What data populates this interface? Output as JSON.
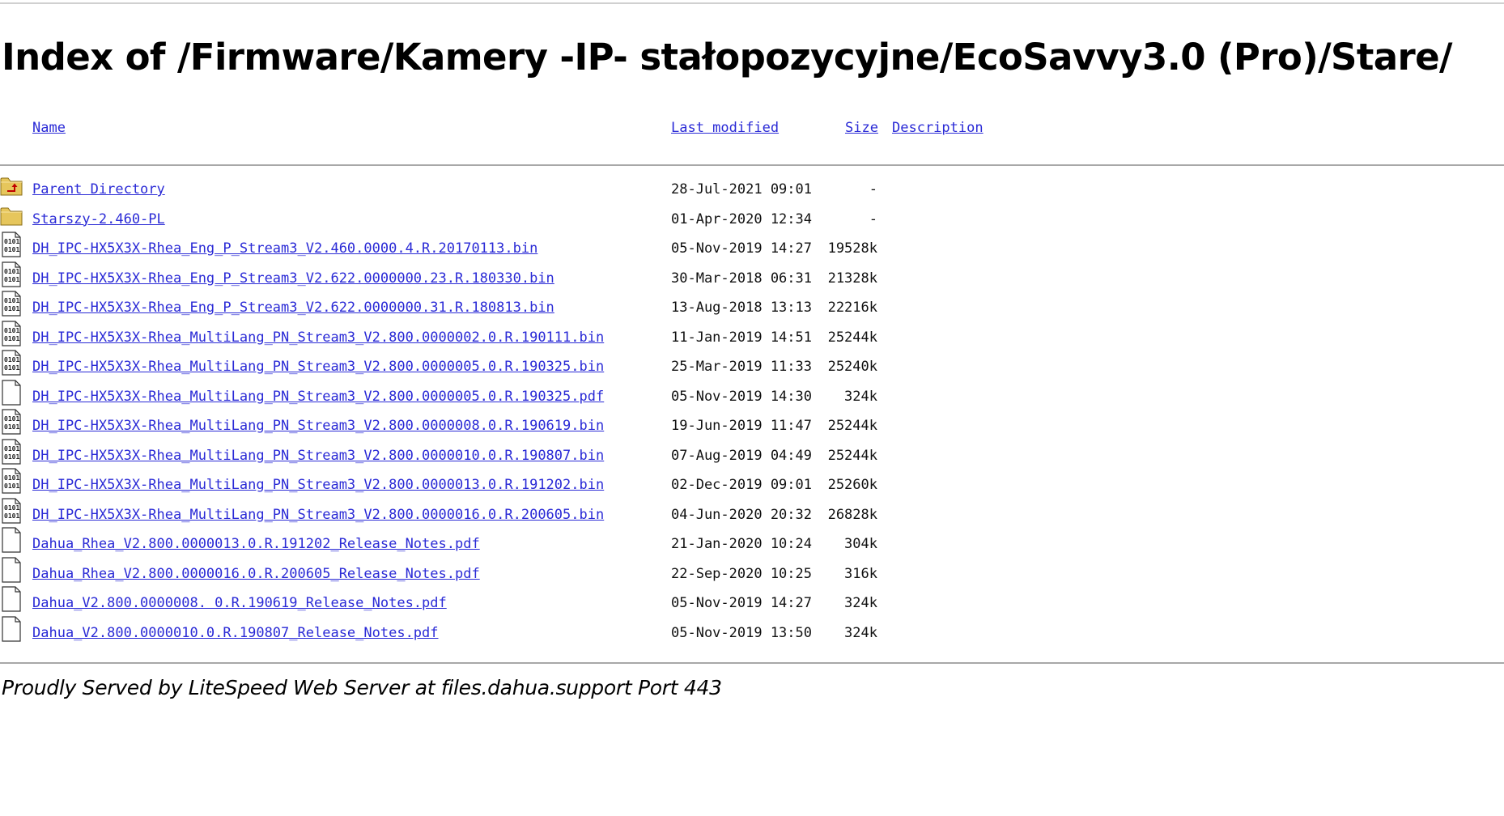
{
  "page": {
    "title": "Index of /Firmware/Kamery -IP- stałopozycyjne/EcoSavvy3.0 (Pro)/Stare/"
  },
  "columns": {
    "name": "Name",
    "last_modified": "Last modified",
    "size": "Size",
    "description": "Description"
  },
  "entries": [
    {
      "icon": "folder-up-icon",
      "name": "Parent Directory",
      "modified": "28-Jul-2021 09:01",
      "size": "-"
    },
    {
      "icon": "folder-icon",
      "name": "Starszy-2.460-PL",
      "modified": "01-Apr-2020 12:34",
      "size": "-"
    },
    {
      "icon": "binary-file-icon",
      "name": "DH_IPC-HX5X3X-Rhea_Eng_P_Stream3_V2.460.0000.4.R.20170113.bin",
      "modified": "05-Nov-2019 14:27",
      "size": "19528k"
    },
    {
      "icon": "binary-file-icon",
      "name": "DH_IPC-HX5X3X-Rhea_Eng_P_Stream3_V2.622.0000000.23.R.180330.bin",
      "modified": "30-Mar-2018 06:31",
      "size": "21328k"
    },
    {
      "icon": "binary-file-icon",
      "name": "DH_IPC-HX5X3X-Rhea_Eng_P_Stream3_V2.622.0000000.31.R.180813.bin",
      "modified": "13-Aug-2018 13:13",
      "size": "22216k"
    },
    {
      "icon": "binary-file-icon",
      "name": "DH_IPC-HX5X3X-Rhea_MultiLang_PN_Stream3_V2.800.0000002.0.R.190111.bin",
      "modified": "11-Jan-2019 14:51",
      "size": "25244k"
    },
    {
      "icon": "binary-file-icon",
      "name": "DH_IPC-HX5X3X-Rhea_MultiLang_PN_Stream3_V2.800.0000005.0.R.190325.bin",
      "modified": "25-Mar-2019 11:33",
      "size": "25240k"
    },
    {
      "icon": "blank-file-icon",
      "name": "DH_IPC-HX5X3X-Rhea_MultiLang_PN_Stream3_V2.800.0000005.0.R.190325.pdf",
      "modified": "05-Nov-2019 14:30",
      "size": "324k"
    },
    {
      "icon": "binary-file-icon",
      "name": "DH_IPC-HX5X3X-Rhea_MultiLang_PN_Stream3_V2.800.0000008.0.R.190619.bin",
      "modified": "19-Jun-2019 11:47",
      "size": "25244k"
    },
    {
      "icon": "binary-file-icon",
      "name": "DH_IPC-HX5X3X-Rhea_MultiLang_PN_Stream3_V2.800.0000010.0.R.190807.bin",
      "modified": "07-Aug-2019 04:49",
      "size": "25244k"
    },
    {
      "icon": "binary-file-icon",
      "name": "DH_IPC-HX5X3X-Rhea_MultiLang_PN_Stream3_V2.800.0000013.0.R.191202.bin",
      "modified": "02-Dec-2019 09:01",
      "size": "25260k"
    },
    {
      "icon": "binary-file-icon",
      "name": "DH_IPC-HX5X3X-Rhea_MultiLang_PN_Stream3_V2.800.0000016.0.R.200605.bin",
      "modified": "04-Jun-2020 20:32",
      "size": "26828k"
    },
    {
      "icon": "blank-file-icon",
      "name": "Dahua_Rhea_V2.800.0000013.0.R.191202_Release_Notes.pdf",
      "modified": "21-Jan-2020 10:24",
      "size": "304k"
    },
    {
      "icon": "blank-file-icon",
      "name": "Dahua_Rhea_V2.800.0000016.0.R.200605_Release_Notes.pdf",
      "modified": "22-Sep-2020 10:25",
      "size": "316k"
    },
    {
      "icon": "blank-file-icon",
      "name": "Dahua_V2.800.0000008. 0.R.190619_Release_Notes.pdf",
      "modified": "05-Nov-2019 14:27",
      "size": "324k"
    },
    {
      "icon": "blank-file-icon",
      "name": "Dahua_V2.800.0000010.0.R.190807_Release_Notes.pdf",
      "modified": "05-Nov-2019 13:50",
      "size": "324k"
    }
  ],
  "footer": {
    "address": "Proudly Served by LiteSpeed Web Server at files.dahua.support Port 443"
  }
}
